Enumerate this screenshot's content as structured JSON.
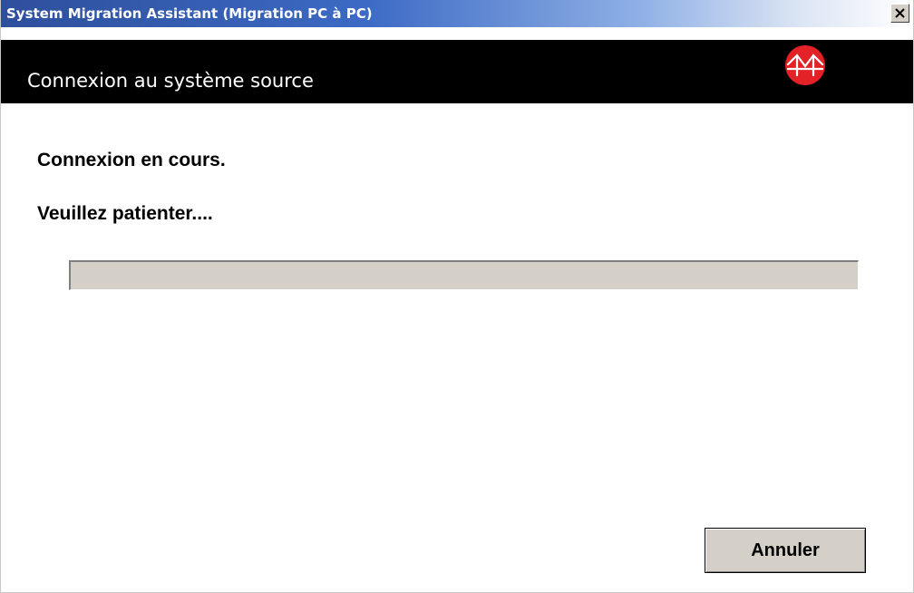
{
  "window": {
    "title": "System Migration Assistant (Migration PC à PC)",
    "close_icon": "close-icon"
  },
  "header": {
    "title": "Connexion au système source",
    "logo_icon": "bridge-logo-icon",
    "logo_color": "#e32228"
  },
  "main": {
    "status_line_1": "Connexion en cours.",
    "status_line_2": "Veuillez patienter....",
    "progress_fraction": 0
  },
  "footer": {
    "cancel_label": "Annuler"
  },
  "colors": {
    "header_background": "#000000",
    "dialog_face": "#d4d0c8",
    "titlebar_start": "#2e4f9c"
  }
}
